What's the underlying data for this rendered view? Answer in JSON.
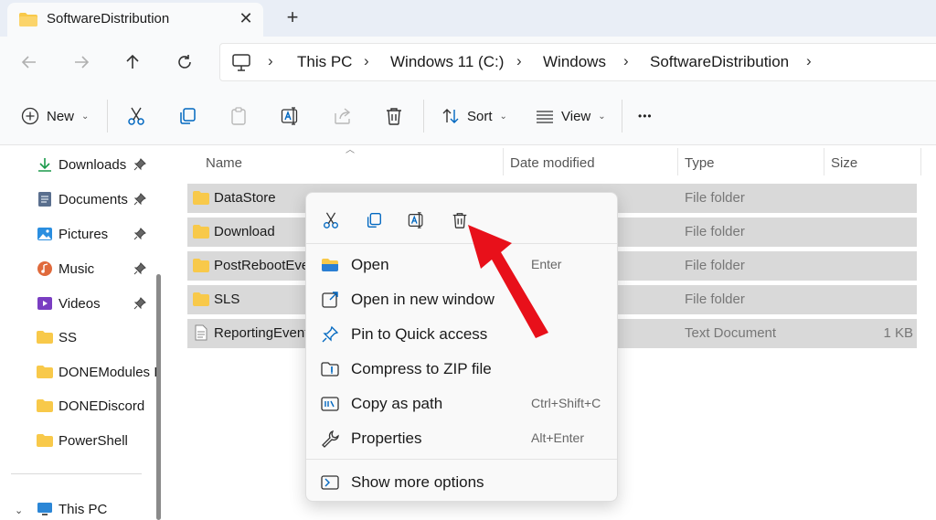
{
  "tab": {
    "title": "SoftwareDistribution",
    "close": "✕",
    "add": "+"
  },
  "breadcrumbs": [
    "This PC",
    "Windows 11 (C:)",
    "Windows",
    "SoftwareDistribution"
  ],
  "breadcrumb_sep": "›",
  "toolbar": {
    "new_label": "New",
    "sort_label": "Sort",
    "view_label": "View",
    "more_label": "•••"
  },
  "sidebar": {
    "items": [
      {
        "label": "Downloads",
        "icon": "download-icon"
      },
      {
        "label": "Documents",
        "icon": "documents-icon"
      },
      {
        "label": "Pictures",
        "icon": "pictures-icon"
      },
      {
        "label": "Music",
        "icon": "music-icon"
      },
      {
        "label": "Videos",
        "icon": "videos-icon"
      },
      {
        "label": "SS",
        "icon": "folder-icon"
      },
      {
        "label": "DONEModules I",
        "icon": "folder-icon"
      },
      {
        "label": "DONEDiscord",
        "icon": "folder-icon"
      },
      {
        "label": "PowerShell",
        "icon": "folder-icon"
      }
    ],
    "this_pc": "This PC"
  },
  "columns": {
    "name": "Name",
    "date": "Date modified",
    "type": "Type",
    "size": "Size"
  },
  "files": [
    {
      "name": "DataStore",
      "type": "File folder",
      "size": ""
    },
    {
      "name": "Download",
      "type": "File folder",
      "size": ""
    },
    {
      "name": "PostRebootEver",
      "type": "File folder",
      "size": ""
    },
    {
      "name": "SLS",
      "type": "File folder",
      "size": ""
    },
    {
      "name": "ReportingEvents",
      "type": "Text Document",
      "size": "1 KB"
    }
  ],
  "context_menu": {
    "quick_actions": [
      "cut-icon",
      "copy-icon",
      "rename-icon",
      "delete-icon"
    ],
    "items": [
      {
        "label": "Open",
        "shortcut": "Enter",
        "icon": "folder-open-icon"
      },
      {
        "label": "Open in new window",
        "shortcut": "",
        "icon": "new-window-icon"
      },
      {
        "label": "Pin to Quick access",
        "shortcut": "",
        "icon": "pin-icon"
      },
      {
        "label": "Compress to ZIP file",
        "shortcut": "",
        "icon": "zip-icon"
      },
      {
        "label": "Copy as path",
        "shortcut": "Ctrl+Shift+C",
        "icon": "copy-path-icon"
      },
      {
        "label": "Properties",
        "shortcut": "Alt+Enter",
        "icon": "wrench-icon"
      }
    ],
    "more_options": "Show more options"
  },
  "colors": {
    "accent": "#0067c0",
    "selection": "#d9d9d9",
    "annotation_arrow": "#e8101a",
    "folder": "#f8c94a"
  }
}
